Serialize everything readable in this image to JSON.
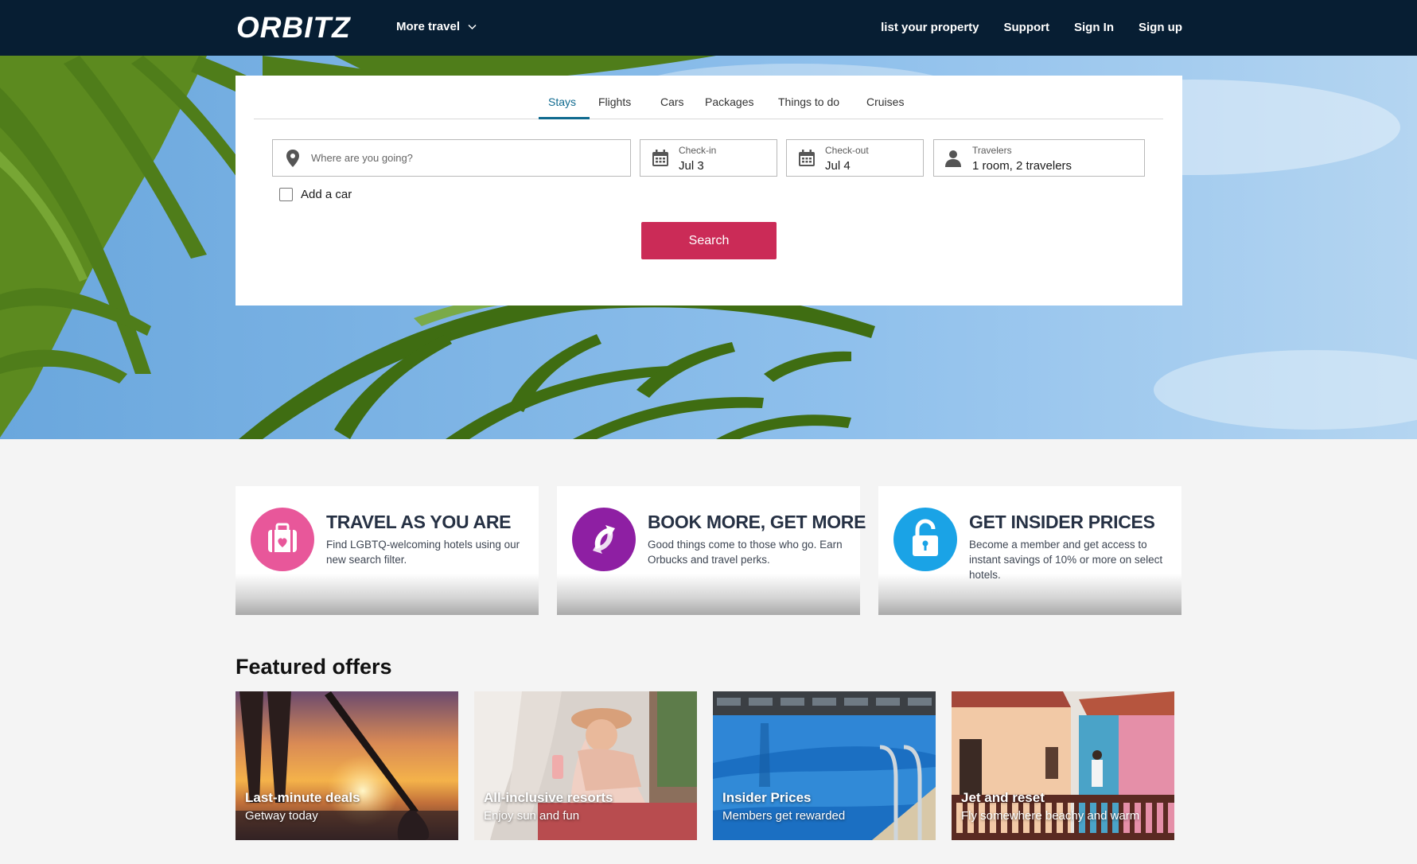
{
  "header": {
    "logo_text": "ORBITZ",
    "more_travel": "More travel",
    "links": [
      "list your property",
      "Support",
      "Sign In",
      "Sign up"
    ]
  },
  "search": {
    "tabs": [
      "Stays",
      "Flights",
      "Cars",
      "Packages",
      "Things to do",
      "Cruises"
    ],
    "active_tab": "Stays",
    "destination_placeholder": "Where are you going?",
    "checkin_label": "Check-in",
    "checkin_value": "Jul 3",
    "checkout_label": "Check-out",
    "checkout_value": "Jul 4",
    "travelers_label": "Travelers",
    "travelers_value": "1 room, 2 travelers",
    "add_car_label": "Add a car",
    "add_car_checked": false,
    "search_button": "Search"
  },
  "promos": [
    {
      "title": "TRAVEL AS YOU ARE",
      "text": "Find LGBTQ-welcoming hotels using our new search filter.",
      "color": "#e8579a",
      "icon": "suitcase-heart-icon"
    },
    {
      "title": "BOOK MORE, GET MORE",
      "text": "Good things come to those who go. Earn Orbucks and travel perks.",
      "color": "#8e1fa3",
      "icon": "orbucks-icon"
    },
    {
      "title": "GET INSIDER PRICES",
      "text": "Become a member and get access to instant savings of 10% or more on select hotels.",
      "color": "#1aa3e6",
      "icon": "unlock-icon"
    }
  ],
  "featured": {
    "title": "Featured offers",
    "offers": [
      {
        "title": "Last-minute deals",
        "subtitle": "Getway today"
      },
      {
        "title": "All-inclusive resorts",
        "subtitle": "Enjoy sun and fun"
      },
      {
        "title": "Insider Prices",
        "subtitle": "Members get rewarded"
      },
      {
        "title": "Jet and reset",
        "subtitle": "Fly somewhere beachy and warm"
      }
    ]
  },
  "colors": {
    "header_bg": "#071e33",
    "accent_tab": "#0f6a8f",
    "search_button": "#cb2b57"
  }
}
